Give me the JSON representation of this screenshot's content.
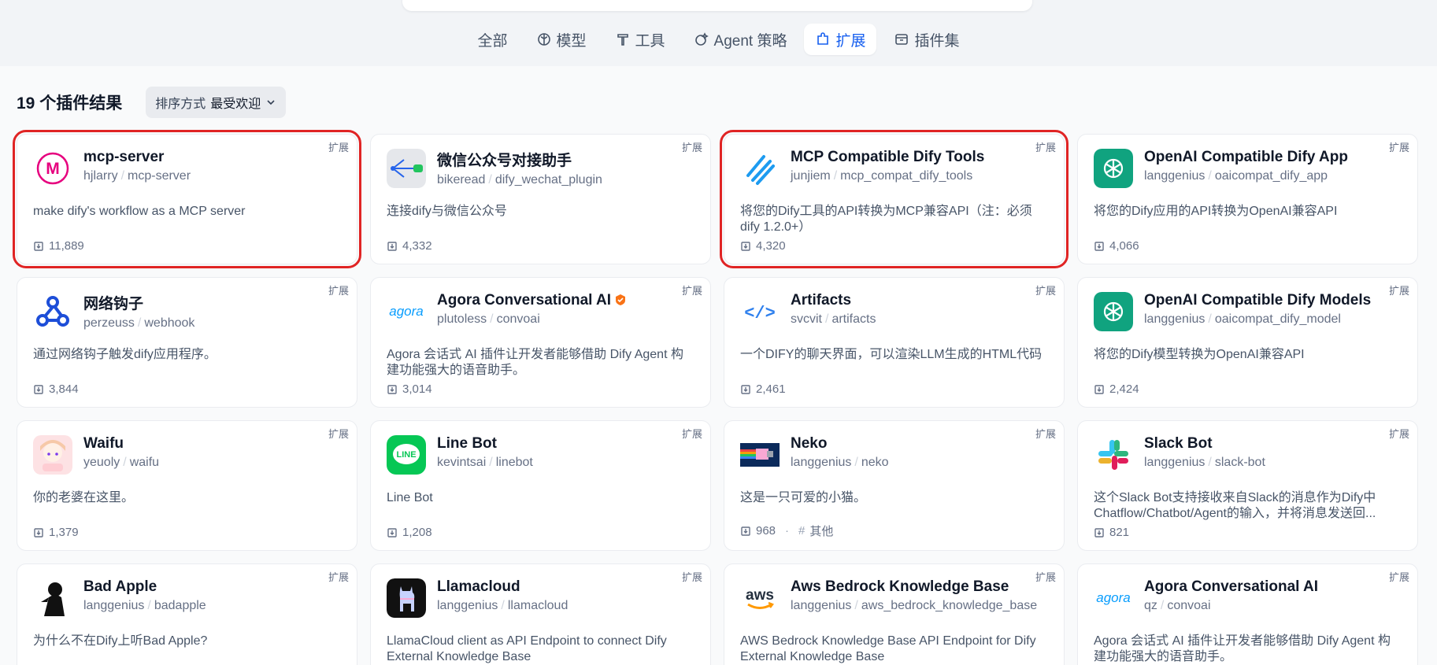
{
  "tabs": [
    {
      "label": "全部",
      "icon": "none",
      "active": false
    },
    {
      "label": "模型",
      "icon": "brain-icon",
      "active": false
    },
    {
      "label": "工具",
      "icon": "hammer-icon",
      "active": false
    },
    {
      "label": "Agent 策略",
      "icon": "agent-icon",
      "active": false
    },
    {
      "label": "扩展",
      "icon": "extension-icon",
      "active": true
    },
    {
      "label": "插件集",
      "icon": "bundle-icon",
      "active": false
    }
  ],
  "results": {
    "count_label": "19 个插件结果",
    "sort_prefix": "排序方式",
    "sort_value": "最受欢迎"
  },
  "cards": [
    {
      "name": "mcp-server",
      "org": "hjlarry",
      "slug": "mcp-server",
      "desc": "make dify's workflow as a MCP server",
      "downloads": "11,889",
      "tag": "扩展",
      "logo": "mcp-m-logo",
      "highlight": true
    },
    {
      "name": "微信公众号对接助手",
      "org": "bikeread",
      "slug": "dify_wechat_plugin",
      "desc": "连接dify与微信公众号",
      "downloads": "4,332",
      "tag": "扩展",
      "logo": "wechat-flow-logo",
      "highlight": false
    },
    {
      "name": "MCP Compatible Dify Tools",
      "org": "junjiem",
      "slug": "mcp_compat_dify_tools",
      "desc": "将您的Dify工具的API转换为MCP兼容API（注：必须 dify 1.2.0+）",
      "downloads": "4,320",
      "tag": "扩展",
      "logo": "mcp-clip-logo",
      "highlight": true
    },
    {
      "name": "OpenAI Compatible Dify App",
      "org": "langgenius",
      "slug": "oaicompat_dify_app",
      "desc": "将您的Dify应用的API转换为OpenAI兼容API",
      "downloads": "4,066",
      "tag": "扩展",
      "logo": "openai-logo",
      "highlight": false
    },
    {
      "name": "网络钩子",
      "org": "perzeuss",
      "slug": "webhook",
      "desc": "通过网络钩子触发dify应用程序。",
      "downloads": "3,844",
      "tag": "扩展",
      "logo": "webhook-logo",
      "highlight": false
    },
    {
      "name": "Agora Conversational AI",
      "org": "plutoless",
      "slug": "convoai",
      "desc": "Agora 会话式 AI 插件让开发者能够借助 Dify Agent 构建功能强大的语音助手。",
      "downloads": "3,014",
      "tag": "扩展",
      "logo": "agora-logo",
      "highlight": false,
      "badge": true
    },
    {
      "name": "Artifacts",
      "org": "svcvit",
      "slug": "artifacts",
      "desc": "一个DIFY的聊天界面，可以渲染LLM生成的HTML代码",
      "downloads": "2,461",
      "tag": "扩展",
      "logo": "code-logo",
      "highlight": false
    },
    {
      "name": "OpenAI Compatible Dify Models",
      "org": "langgenius",
      "slug": "oaicompat_dify_model",
      "desc": "将您的Dify模型转换为OpenAI兼容API",
      "downloads": "2,424",
      "tag": "扩展",
      "logo": "openai-logo",
      "highlight": false
    },
    {
      "name": "Waifu",
      "org": "yeuoly",
      "slug": "waifu",
      "desc": "你的老婆在这里。",
      "downloads": "1,379",
      "tag": "扩展",
      "logo": "anime-avatar-logo",
      "highlight": false
    },
    {
      "name": "Line Bot",
      "org": "kevintsai",
      "slug": "linebot",
      "desc": "Line Bot",
      "downloads": "1,208",
      "tag": "扩展",
      "logo": "line-logo",
      "highlight": false
    },
    {
      "name": "Neko",
      "org": "langgenius",
      "slug": "neko",
      "desc": "这是一只可爱的小猫。",
      "downloads": "968",
      "category": "其他",
      "tag": "扩展",
      "logo": "nyan-cat-logo",
      "highlight": false
    },
    {
      "name": "Slack Bot",
      "org": "langgenius",
      "slug": "slack-bot",
      "desc": "这个Slack Bot支持接收来自Slack的消息作为Dify中Chatflow/Chatbot/Agent的输入，并将消息发送回...",
      "downloads": "821",
      "tag": "扩展",
      "logo": "slack-logo",
      "highlight": false
    },
    {
      "name": "Bad Apple",
      "org": "langgenius",
      "slug": "badapple",
      "desc": "为什么不在Dify上听Bad Apple?",
      "downloads": "",
      "tag": "扩展",
      "logo": "silhouette-logo",
      "highlight": false
    },
    {
      "name": "Llamacloud",
      "org": "langgenius",
      "slug": "llamacloud",
      "desc": "LlamaCloud client as API Endpoint to connect Dify External Knowledge Base",
      "downloads": "",
      "tag": "扩展",
      "logo": "llama-logo",
      "highlight": false
    },
    {
      "name": "Aws Bedrock Knowledge Base",
      "org": "langgenius",
      "slug": "aws_bedrock_knowledge_base",
      "desc": "AWS Bedrock Knowledge Base API Endpoint for Dify External Knowledge Base",
      "downloads": "",
      "tag": "扩展",
      "logo": "aws-logo",
      "highlight": false
    },
    {
      "name": "Agora Conversational AI",
      "org": "qz",
      "slug": "convoai",
      "desc": "Agora 会话式 AI 插件让开发者能够借助 Dify Agent 构建功能强大的语音助手。",
      "downloads": "",
      "tag": "扩展",
      "logo": "agora-logo",
      "highlight": false
    }
  ],
  "logo_text": {
    "mcp": "M",
    "agora": "agora",
    "aws": "aws",
    "line": "LINE",
    "code": "</>"
  },
  "colors": {
    "accent": "#155eef",
    "highlight": "#e02424",
    "openai": "#10a37f",
    "line": "#06c755",
    "mcp_pink": "#e6007e",
    "agora_blue": "#099dfd"
  }
}
